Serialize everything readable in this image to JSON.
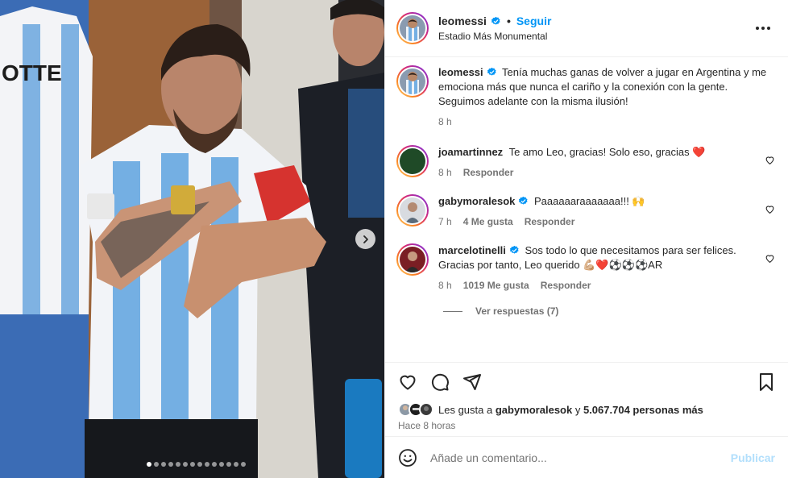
{
  "post": {
    "username": "leomessi",
    "follow_label": "Seguir",
    "separator": "•",
    "location": "Estadio Más Monumental",
    "jersey_text": "OTTE",
    "caption": {
      "username": "leomessi",
      "text": "Tenía muchas ganas de volver a jugar en Argentina y me emociona más que nunca el cariño y la conexión con la gente. Seguimos adelante con la misma ilusión!",
      "time": "8 h"
    },
    "comments": [
      {
        "username": "joamartinnez",
        "text": "Te amo Leo, gracias! Solo eso, gracias ❤️",
        "time": "8 h",
        "likes": "",
        "reply": "Responder",
        "verified": false
      },
      {
        "username": "gabymoralesok",
        "text": "Paaaaaaraaaaaaa!!! 🙌",
        "time": "7 h",
        "likes": "4 Me gusta",
        "reply": "Responder",
        "verified": true
      },
      {
        "username": "marcelotinelli",
        "text": "Sos todo lo que necesitamos para ser felices. Gracias por tanto, Leo querido 💪🏼❤️⚽⚽⚽AR",
        "time": "8 h",
        "likes": "1019 Me gusta",
        "reply": "Responder",
        "verified": true
      }
    ],
    "view_replies": "Ver respuestas (7)",
    "likes_line": {
      "prefix": "Les gusta a",
      "user": "gabymoralesok",
      "connector": "y",
      "count": "5.067.704 personas más"
    },
    "time_ago": "Hace 8 horas",
    "comment_placeholder": "Añade un comentario...",
    "publish_label": "Publicar",
    "carousel": {
      "slides": 14,
      "active": 1
    },
    "colors": {
      "accent": "#0095f6",
      "verified": "#0095f6",
      "text": "#262626",
      "muted": "#737373"
    }
  }
}
